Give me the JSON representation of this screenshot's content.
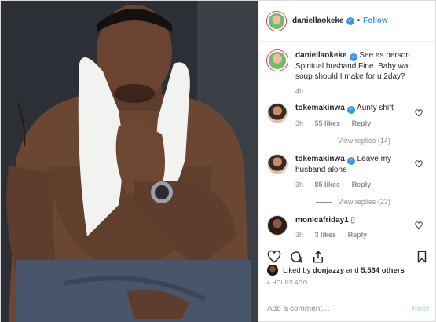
{
  "header": {
    "username": "daniellaokeke",
    "separator": "•",
    "follow_label": "Follow"
  },
  "caption": {
    "username": "daniellaokeke",
    "text": "See as person Spiritual husband Fine. Baby wat soup should I make for u 2day?",
    "time": "4h"
  },
  "comments": [
    {
      "username": "tokemakinwa",
      "text": "Aunty shift",
      "time": "3h",
      "likes": "55 likes",
      "reply": "Reply",
      "view_replies": "View replies (14)"
    },
    {
      "username": "tokemakinwa",
      "text": "Leave my husband alone",
      "time": "3h",
      "likes": "85 likes",
      "reply": "Reply",
      "view_replies": "View replies (23)"
    },
    {
      "username": "monicafriday1",
      "text": "▯",
      "time": "3h",
      "likes": "3 likes",
      "reply": "Reply"
    }
  ],
  "likes": {
    "prefix": "Liked by",
    "user": "donjazzy",
    "connector": "and",
    "count": "5,534 others"
  },
  "timestamp": "4 HOURS AGO",
  "add_comment": {
    "placeholder": "Add a comment…",
    "post_label": "Post"
  },
  "colors": {
    "accent": "#3897f0",
    "muted": "#8e8e8e",
    "post_disabled": "#b2dffc"
  },
  "icons": [
    "heart-icon",
    "comment-icon",
    "share-icon",
    "bookmark-icon",
    "verified-icon"
  ]
}
